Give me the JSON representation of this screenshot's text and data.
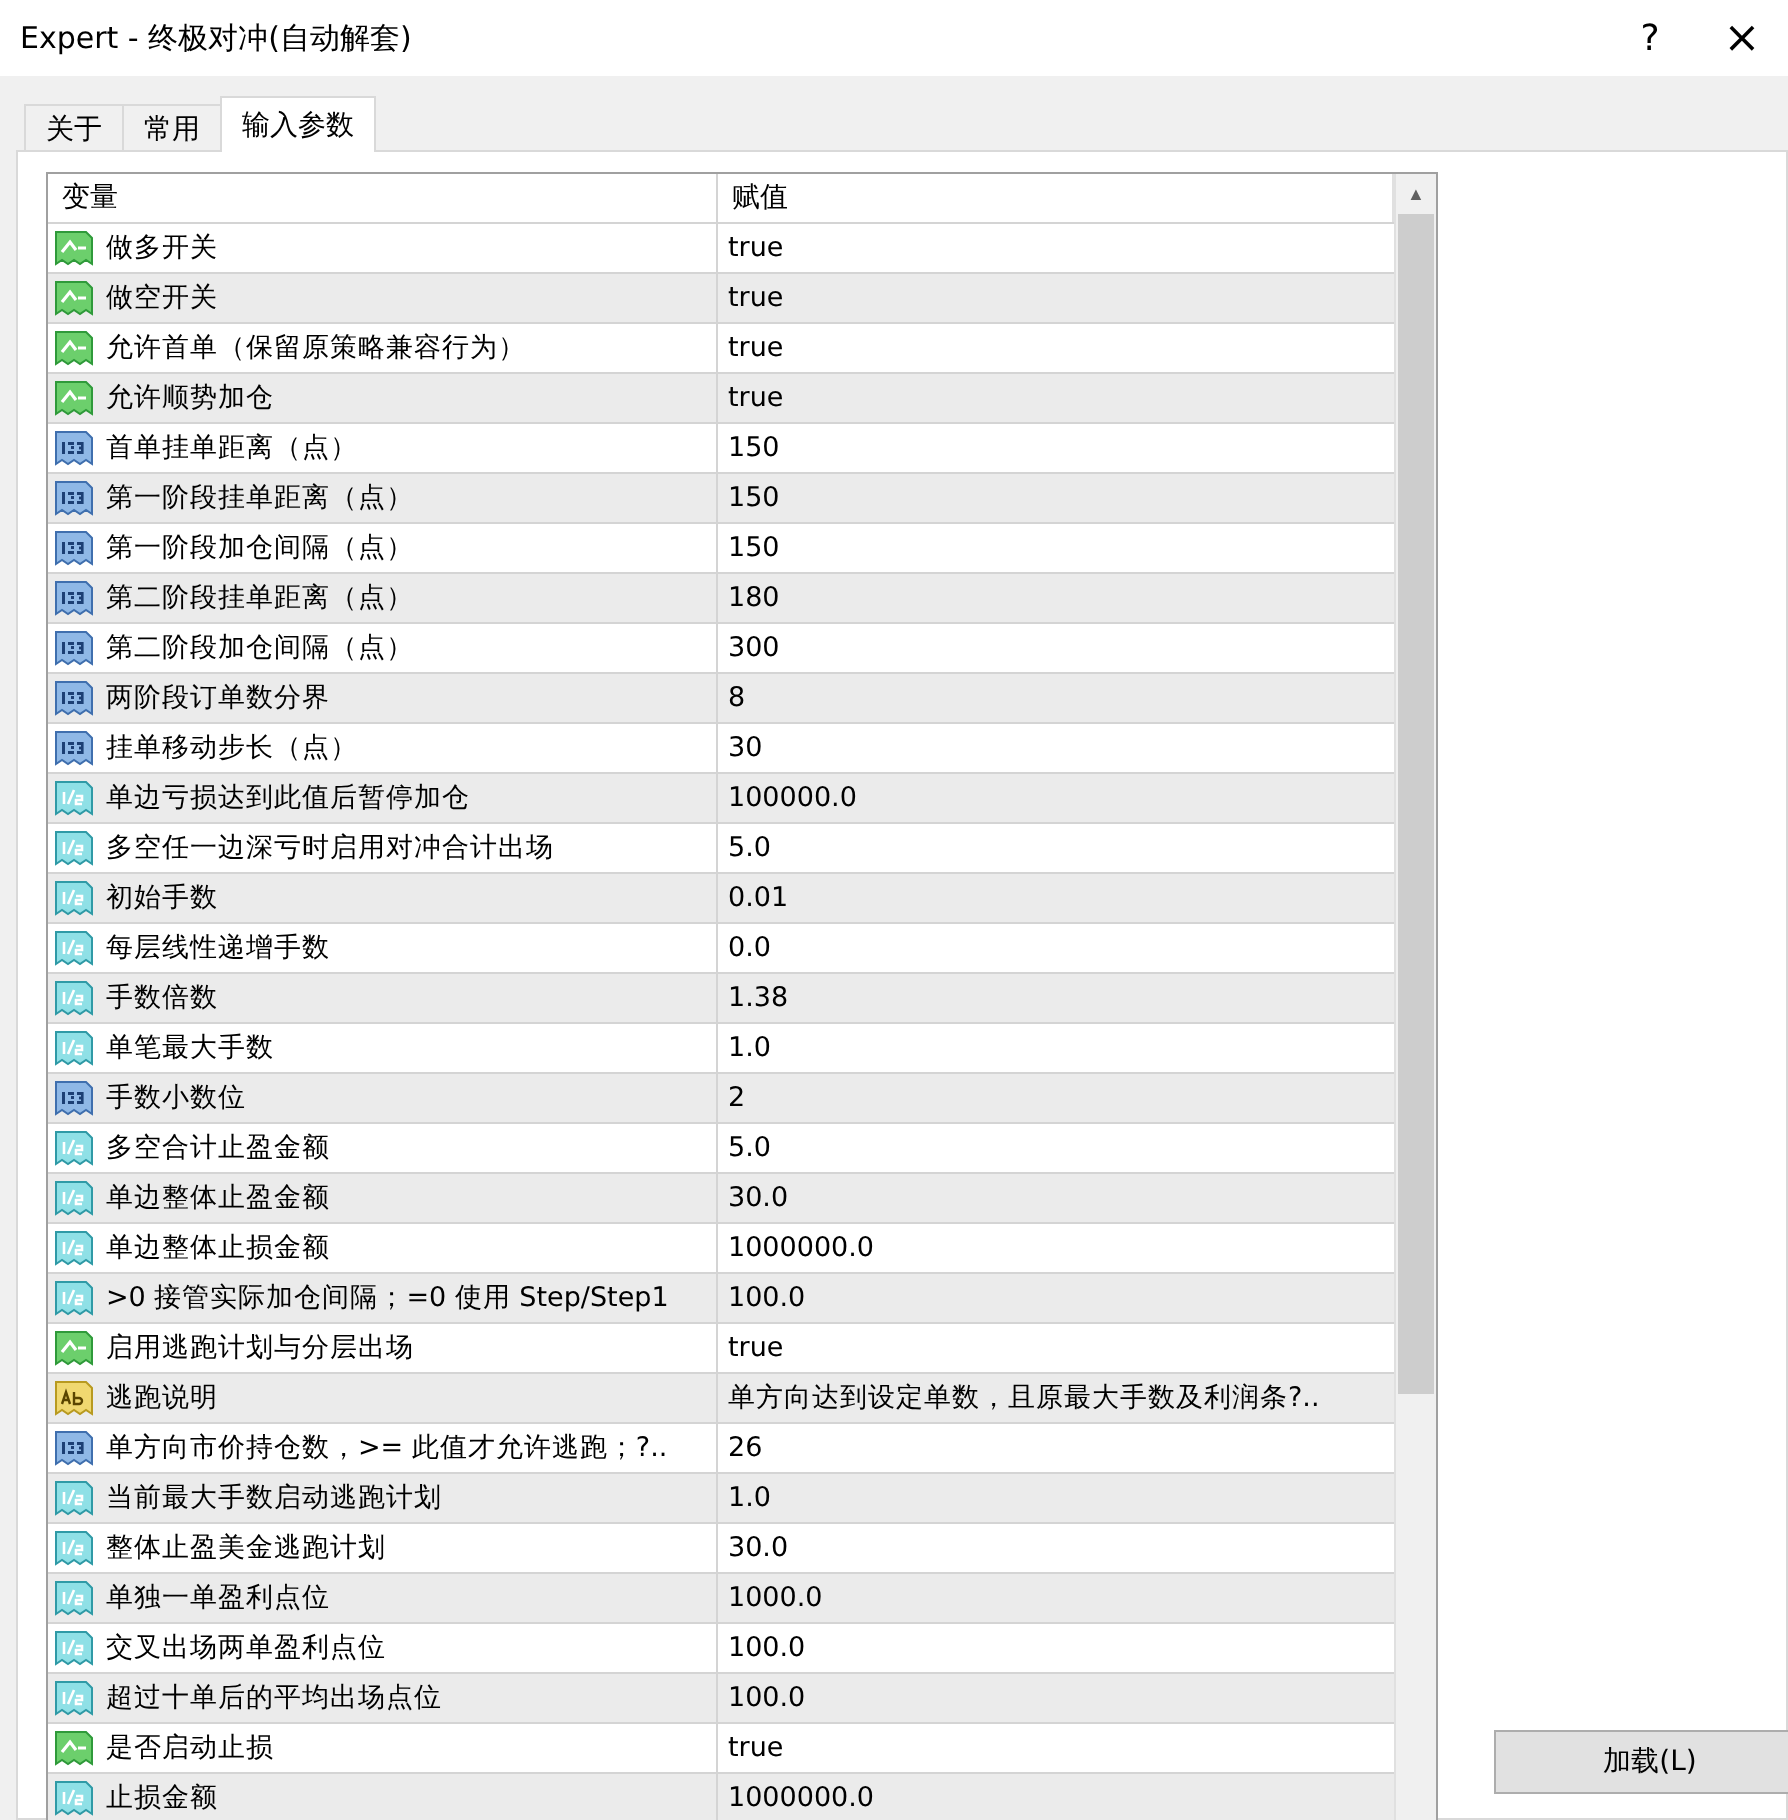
{
  "window": {
    "title": "Expert - 终极对冲(自动解套)",
    "help": "?",
    "close": "×"
  },
  "tabs": [
    {
      "label": "关于",
      "selected": false
    },
    {
      "label": "常用",
      "selected": false
    },
    {
      "label": "输入参数",
      "selected": true
    }
  ],
  "table": {
    "columns": [
      "变量",
      "赋值"
    ],
    "rows": [
      {
        "kind": "bool",
        "name": "做多开关",
        "value": "true"
      },
      {
        "kind": "bool",
        "name": "做空开关",
        "value": "true"
      },
      {
        "kind": "bool",
        "name": "允许首单（保留原策略兼容行为）",
        "value": "true"
      },
      {
        "kind": "bool",
        "name": "允许顺势加仓",
        "value": "true"
      },
      {
        "kind": "int",
        "name": "首单挂单距离（点）",
        "value": "150"
      },
      {
        "kind": "int",
        "name": "第一阶段挂单距离（点）",
        "value": "150"
      },
      {
        "kind": "int",
        "name": "第一阶段加仓间隔（点）",
        "value": "150"
      },
      {
        "kind": "int",
        "name": "第二阶段挂单距离（点）",
        "value": "180"
      },
      {
        "kind": "int",
        "name": "第二阶段加仓间隔（点）",
        "value": "300"
      },
      {
        "kind": "int",
        "name": "两阶段订单数分界",
        "value": "8"
      },
      {
        "kind": "int",
        "name": "挂单移动步长（点）",
        "value": "30"
      },
      {
        "kind": "double",
        "name": "单边亏损达到此值后暂停加仓",
        "value": "100000.0"
      },
      {
        "kind": "double",
        "name": "多空任一边深亏时启用对冲合计出场",
        "value": "5.0"
      },
      {
        "kind": "double",
        "name": "初始手数",
        "value": "0.01"
      },
      {
        "kind": "double",
        "name": "每层线性递增手数",
        "value": "0.0"
      },
      {
        "kind": "double",
        "name": "手数倍数",
        "value": "1.38"
      },
      {
        "kind": "double",
        "name": "单笔最大手数",
        "value": "1.0"
      },
      {
        "kind": "int",
        "name": "手数小数位",
        "value": "2"
      },
      {
        "kind": "double",
        "name": "多空合计止盈金额",
        "value": "5.0"
      },
      {
        "kind": "double",
        "name": "单边整体止盈金额",
        "value": "30.0"
      },
      {
        "kind": "double",
        "name": "单边整体止损金额",
        "value": "1000000.0"
      },
      {
        "kind": "double",
        "name": ">0 接管实际加仓间隔；=0 使用 Step/Step1",
        "value": "100.0"
      },
      {
        "kind": "bool",
        "name": "启用逃跑计划与分层出场",
        "value": "true"
      },
      {
        "kind": "string",
        "name": "逃跑说明",
        "value": "单方向达到设定单数，且原最大手数及利润条?.."
      },
      {
        "kind": "int",
        "name": "单方向市价持仓数，>= 此值才允许逃跑；?..",
        "value": "26"
      },
      {
        "kind": "double",
        "name": "当前最大手数启动逃跑计划",
        "value": "1.0"
      },
      {
        "kind": "double",
        "name": "整体止盈美金逃跑计划",
        "value": "30.0"
      },
      {
        "kind": "double",
        "name": "单独一单盈利点位",
        "value": "1000.0"
      },
      {
        "kind": "double",
        "name": "交叉出场两单盈利点位",
        "value": "100.0"
      },
      {
        "kind": "double",
        "name": "超过十单后的平均出场点位",
        "value": "100.0"
      },
      {
        "kind": "bool",
        "name": "是否启动止损",
        "value": "true"
      },
      {
        "kind": "double",
        "name": "止损金额",
        "value": "1000000.0"
      }
    ]
  },
  "scroll_up": "▲",
  "load_button": "加载(L)"
}
